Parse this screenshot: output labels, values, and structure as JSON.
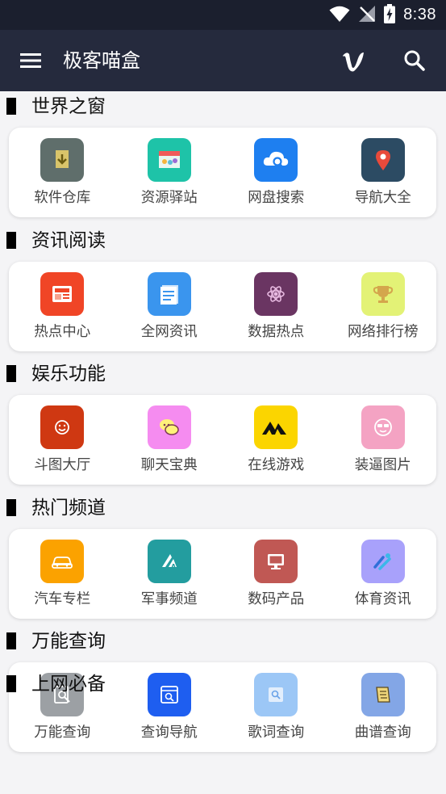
{
  "status_bar": {
    "time": "8:38",
    "icons": [
      "wifi-icon",
      "no-signal-icon",
      "battery-charging-icon"
    ]
  },
  "app_bar": {
    "title": "极客喵盒",
    "icons": [
      "menu-icon",
      "vimeo-icon",
      "search-icon"
    ]
  },
  "sections": [
    {
      "title": "世界之窗",
      "items": [
        {
          "label": "软件仓库",
          "icon": "download-box-icon",
          "color": "#5f6e6b"
        },
        {
          "label": "资源驿站",
          "icon": "store-icon",
          "color": "#1ec3a8"
        },
        {
          "label": "网盘搜索",
          "icon": "cloud-search-icon",
          "color": "#1e7ff0"
        },
        {
          "label": "导航大全",
          "icon": "map-pin-icon",
          "color": "#2c4b63"
        }
      ]
    },
    {
      "title": "资讯阅读",
      "items": [
        {
          "label": "热点中心",
          "icon": "newspaper-icon",
          "color": "#f04526"
        },
        {
          "label": "全网资讯",
          "icon": "document-icon",
          "color": "#3a95ee"
        },
        {
          "label": "数据热点",
          "icon": "atom-icon",
          "color": "#6a3562"
        },
        {
          "label": "网络排行榜",
          "icon": "trophy-icon",
          "color": "#e3f276"
        }
      ]
    },
    {
      "title": "娱乐功能",
      "items": [
        {
          "label": "斗图大厅",
          "icon": "smiley-icon",
          "color": "#cf3812"
        },
        {
          "label": "聊天宝典",
          "icon": "chat-bubble-icon",
          "color": "#f58cf0"
        },
        {
          "label": "在线游戏",
          "icon": "game-logo-icon",
          "color": "#fbd500"
        },
        {
          "label": "装逼图片",
          "icon": "cool-face-icon",
          "color": "#f4a3c3"
        }
      ]
    },
    {
      "title": "热门频道",
      "items": [
        {
          "label": "汽车专栏",
          "icon": "car-icon",
          "color": "#fba200"
        },
        {
          "label": "军事频道",
          "icon": "military-icon",
          "color": "#239d9f"
        },
        {
          "label": "数码产品",
          "icon": "monitor-icon",
          "color": "#c05854"
        },
        {
          "label": "体育资讯",
          "icon": "sports-icon",
          "color": "#a8a1fb"
        }
      ]
    },
    {
      "title": "万能查询",
      "items": [
        {
          "label": "万能查询",
          "icon": "doc-search-icon",
          "color": "#9ca0a4"
        },
        {
          "label": "查询导航",
          "icon": "browser-search-icon",
          "color": "#1e5ef0"
        },
        {
          "label": "歌词查询",
          "icon": "lyrics-search-icon",
          "color": "#9cc7f6"
        },
        {
          "label": "曲谱查询",
          "icon": "score-icon",
          "color": "#83a6e6"
        }
      ]
    }
  ],
  "partial_section": {
    "title": "上网必备"
  }
}
